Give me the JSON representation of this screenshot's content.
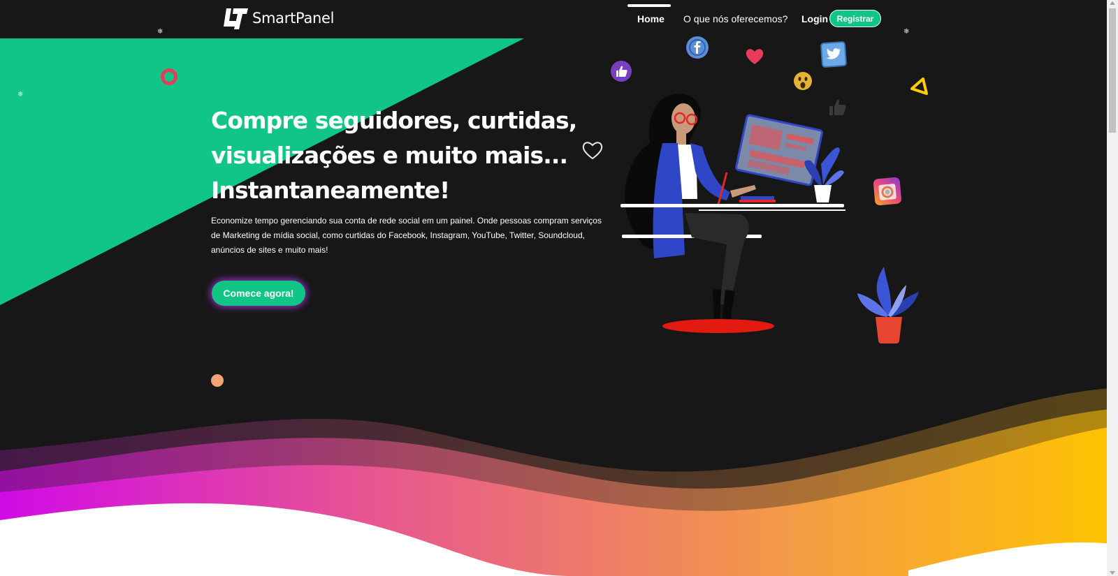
{
  "brand": {
    "name": "SmartPanel",
    "logo_icon": "smartpanel-logo-icon"
  },
  "nav": {
    "home": "Home",
    "offer": "O que nós oferecemos?",
    "login": "Login",
    "register": "Registrar"
  },
  "hero": {
    "title_line1": "Compre seguidores, curtidas,",
    "title_line2": "visualizações e muito mais...",
    "title_line3": "Instantaneamente!",
    "description": "Economize tempo gerenciando sua conta de rede social em um painel. Onde pessoas compram serviços de Marketing de mídia social, como curtidas do Facebook, Instagram, YouTube, Twitter, Soundcloud, anúncios de sites e muito mais!",
    "cta": "Comece agora!"
  },
  "colors": {
    "background": "#171717",
    "accent_green": "#10c586",
    "wave_magenta": "#d10ae6",
    "wave_orange": "#f7a22f",
    "wave_yellow": "#ffc400"
  },
  "icons": [
    "facebook-icon",
    "twitter-icon",
    "thumbs-up-icon",
    "heart-icon",
    "wow-emoji-icon",
    "instagram-icon",
    "heart-outline-icon",
    "triangle-icon",
    "snowflake-icon"
  ],
  "decor": {
    "snowflake": "❄"
  }
}
